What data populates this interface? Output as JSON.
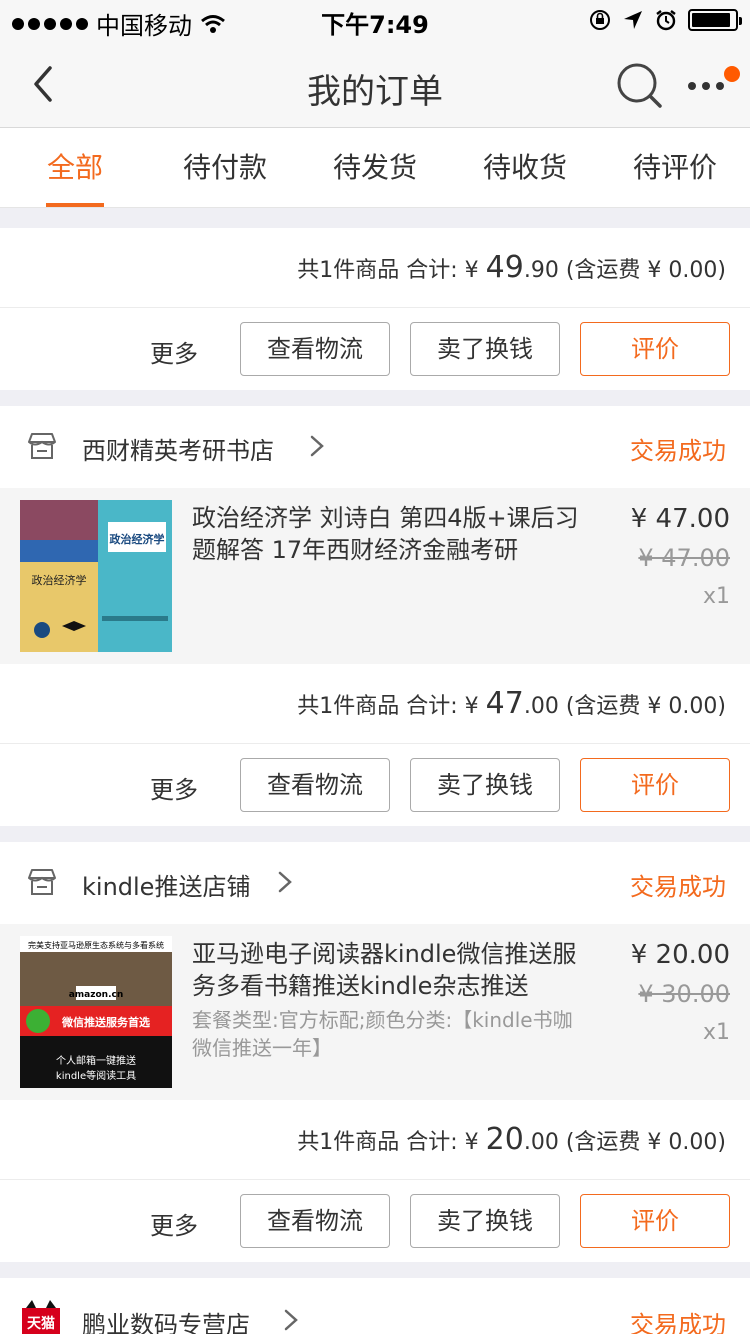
{
  "status_bar": {
    "carrier": "中国移动",
    "time": "下午7:49"
  },
  "nav": {
    "title": "我的订单",
    "back_icon": "chevron-left-icon",
    "search_icon": "search-icon",
    "more_icon": "more-dots-icon",
    "badge_color": "#ff5a00"
  },
  "tabs": [
    "全部",
    "待付款",
    "待发货",
    "待收货",
    "待评价"
  ],
  "accent_color": "#f36a1e",
  "orders": [
    {
      "summary": {
        "prefix": "共1件商品 合计: ¥ ",
        "int": "49",
        "dec": ".90",
        "suffix": " (含运费 ¥ 0.00)"
      },
      "actions": {
        "more": "更多",
        "logistics": "查看物流",
        "sell": "卖了换钱",
        "rate": "评价"
      }
    },
    {
      "shop": {
        "name": "西财精英考研书店",
        "status": "交易成功"
      },
      "item": {
        "title": "政治经济学 刘诗白 第四4版+课后习题解答 17年西财经济金融考研",
        "spec": "",
        "price": "¥ 47.00",
        "orig": "¥ 47.00",
        "qty": "x1",
        "thumb_text_1": "政治经济学",
        "thumb_text_2": "政治经济学"
      },
      "summary": {
        "prefix": "共1件商品 合计: ¥ ",
        "int": "47",
        "dec": ".00",
        "suffix": " (含运费 ¥ 0.00)"
      },
      "actions": {
        "more": "更多",
        "logistics": "查看物流",
        "sell": "卖了换钱",
        "rate": "评价"
      }
    },
    {
      "shop": {
        "name": "kindle推送店铺",
        "status": "交易成功"
      },
      "item": {
        "title": "亚马逊电子阅读器kindle微信推送服务多看书籍推送kindle杂志推送",
        "spec": "套餐类型:官方标配;颜色分类:【kindle书咖微信推送一年】",
        "price": "¥ 20.00",
        "orig": "¥ 30.00",
        "qty": "x1",
        "thumb_text_1": "完美支持亚马逊原生态系统与多看系统",
        "thumb_text_2": "微信推送服务首选",
        "thumb_text_3": "个人邮箱一键推送",
        "thumb_text_4": "kindle等阅读工具",
        "thumb_text_5": "amazon.cn"
      },
      "summary": {
        "prefix": "共1件商品 合计: ¥ ",
        "int": "20",
        "dec": ".00",
        "suffix": " (含运费 ¥ 0.00)"
      },
      "actions": {
        "more": "更多",
        "logistics": "查看物流",
        "sell": "卖了换钱",
        "rate": "评价"
      }
    },
    {
      "shop": {
        "name": "鹏业数码专营店",
        "status": "交易成功",
        "badge": "天猫"
      }
    }
  ]
}
